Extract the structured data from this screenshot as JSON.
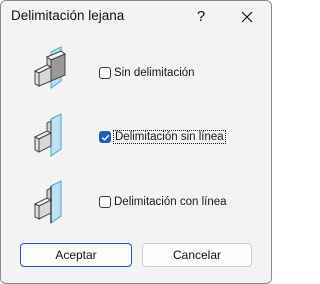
{
  "window": {
    "title": "Delimitación lejana",
    "help_label": "?"
  },
  "options": [
    {
      "label": "Sin delimitación",
      "checked": false,
      "icon": "frustum-no-clip-icon"
    },
    {
      "label": "Delimitación sin línea",
      "checked": true,
      "icon": "frustum-clip-no-line-icon"
    },
    {
      "label": "Delimitación con línea",
      "checked": false,
      "icon": "frustum-clip-with-line-icon"
    }
  ],
  "buttons": {
    "ok_label": "Aceptar",
    "cancel_label": "Cancelar"
  },
  "colors": {
    "accent": "#1a5fb4",
    "plane": "#6fb8e0"
  }
}
